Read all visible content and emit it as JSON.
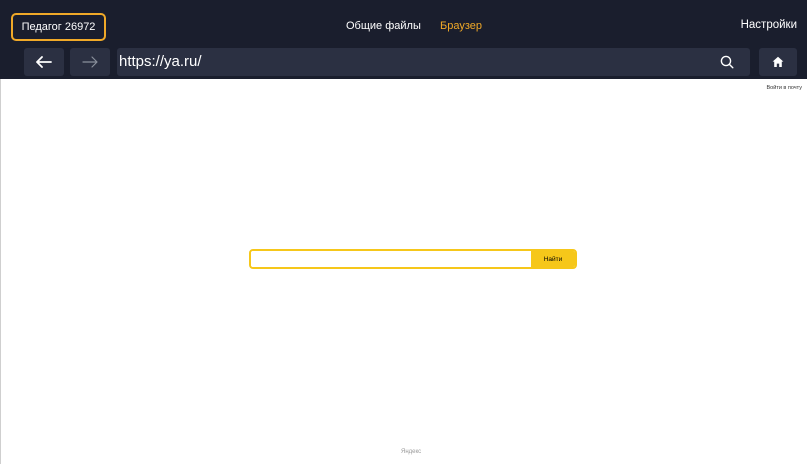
{
  "header": {
    "user_label": "Педагог 26972",
    "tabs": [
      {
        "label": "Общие файлы",
        "active": false
      },
      {
        "label": "Браузер",
        "active": true
      }
    ],
    "settings_label": "Настройки"
  },
  "browser": {
    "url": "https://ya.ru/",
    "back_icon": "arrow-left-icon",
    "forward_icon": "arrow-right-icon",
    "search_icon": "search-icon",
    "home_icon": "home-icon"
  },
  "page": {
    "login_link": "Войти в почту",
    "search_button": "Найти",
    "search_value": "",
    "footer": "Яндекс"
  },
  "colors": {
    "bar_bg": "#1a1e2d",
    "control_bg": "#2b3042",
    "accent": "#f0a928",
    "search_yellow": "#f6c71a"
  }
}
